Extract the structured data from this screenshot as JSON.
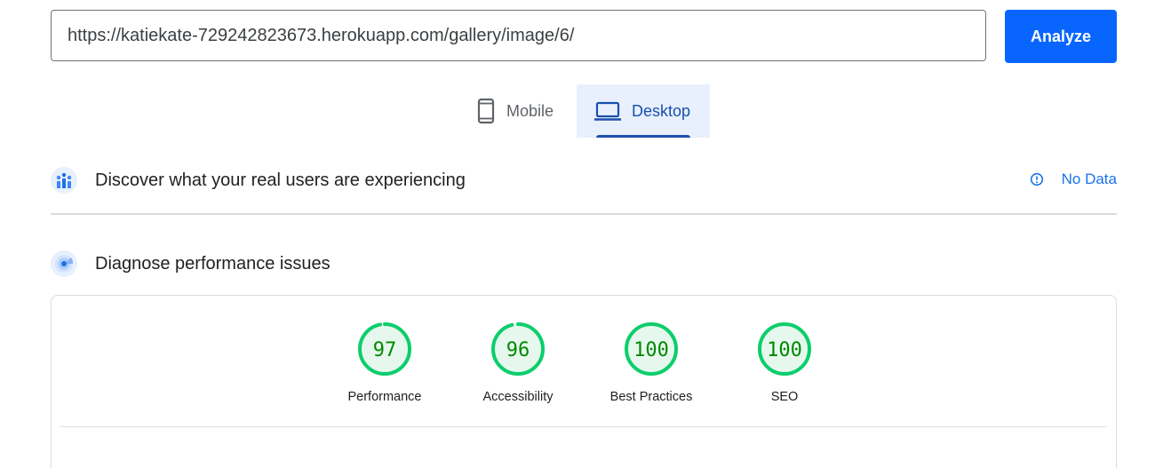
{
  "search": {
    "url_value": "https://katiekate-729242823673.herokuapp.com/gallery/image/6/",
    "analyze_label": "Analyze"
  },
  "tabs": [
    {
      "label": "Mobile",
      "icon": "smartphone-icon",
      "selected": false
    },
    {
      "label": "Desktop",
      "icon": "laptop-icon",
      "selected": true
    }
  ],
  "real_users": {
    "title": "Discover what your real users are experiencing",
    "icon": "users-chart-icon",
    "status_icon": "info-icon",
    "status_label": "No Data"
  },
  "diagnose": {
    "title": "Diagnose performance issues",
    "icon": "radar-icon"
  },
  "scores": [
    {
      "label": "Performance",
      "value": "97",
      "fraction": 0.97
    },
    {
      "label": "Accessibility",
      "value": "96",
      "fraction": 0.96
    },
    {
      "label": "Best Practices",
      "value": "100",
      "fraction": 1.0
    },
    {
      "label": "SEO",
      "value": "100",
      "fraction": 1.0
    }
  ],
  "colors": {
    "accent": "#0866ff",
    "tab_active": "#1a4fad",
    "pass_green": "#0cce6b",
    "pass_fill": "#e6f8ee",
    "pass_text": "#008800"
  }
}
